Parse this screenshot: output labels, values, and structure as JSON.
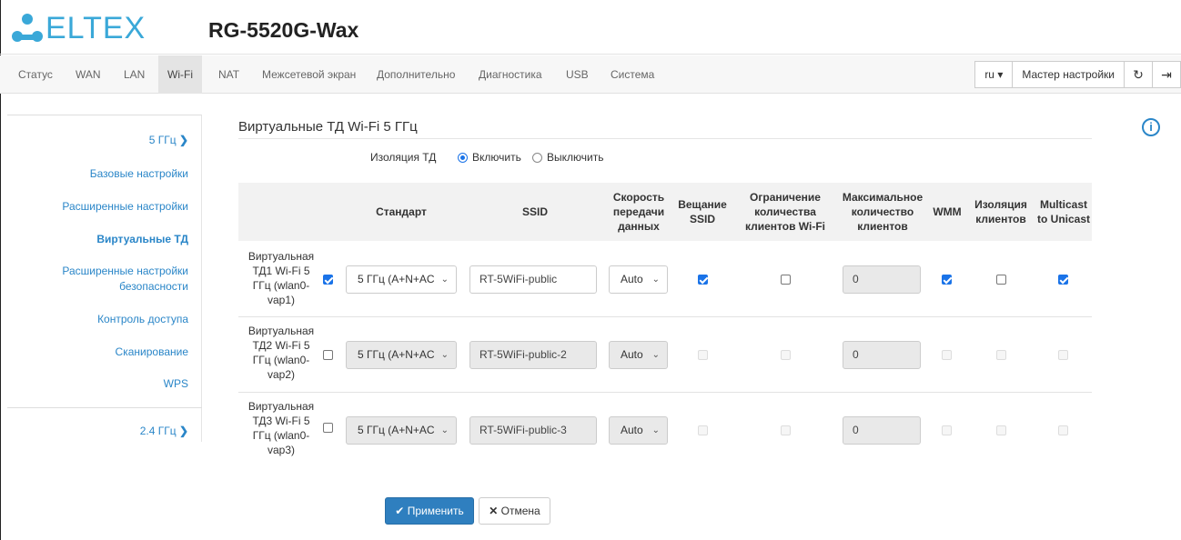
{
  "header": {
    "logo_text": "ELTEX",
    "device_name": "RG-5520G-Wax"
  },
  "topnav": {
    "items": [
      "Статус",
      "WAN",
      "LAN",
      "Wi-Fi",
      "NAT",
      "Межсетевой экран",
      "Дополнительно",
      "Диагностика",
      "USB",
      "Система"
    ],
    "active": "Wi-Fi",
    "lang": "ru ▾",
    "wizard": "Мастер настройки"
  },
  "sidebar": {
    "group_5": "5 ГГц",
    "items": [
      "Базовые настройки",
      "Расширенные настройки",
      "Виртуальные ТД",
      "Расширенные настройки безопасности",
      "Контроль доступа",
      "Сканирование",
      "WPS"
    ],
    "active": "Виртуальные ТД",
    "group_24": "2.4 ГГц"
  },
  "main": {
    "title": "Виртуальные ТД Wi-Fi 5 ГГц",
    "isolation_label": "Изоляция ТД",
    "enable": "Включить",
    "disable": "Выключить",
    "isolation_value": "enable"
  },
  "table": {
    "headers": {
      "standard": "Стандарт",
      "ssid": "SSID",
      "rate": "Скорость передачи данных",
      "broadcast": "Вещание SSID",
      "limit": "Ограничение количества клиентов Wi-Fi",
      "max": "Максимальное количество клиентов",
      "wmm": "WMM",
      "iso": "Изоляция клиентов",
      "mcast": "Multicast to Unicast"
    },
    "rows": [
      {
        "label": "Виртуальная ТД1 Wi-Fi 5 ГГц (wlan0-vap1)",
        "enabled": true,
        "standard": "5 ГГц (A+N+AC",
        "ssid": "RT-5WiFi-public",
        "rate": "Auto",
        "broadcast": true,
        "limit": false,
        "max": "0",
        "wmm": true,
        "iso": false,
        "mcast": true
      },
      {
        "label": "Виртуальная ТД2 Wi-Fi 5 ГГц (wlan0-vap2)",
        "enabled": false,
        "standard": "5 ГГц (A+N+AC",
        "ssid": "RT-5WiFi-public-2",
        "rate": "Auto",
        "broadcast": false,
        "limit": false,
        "max": "0",
        "wmm": false,
        "iso": false,
        "mcast": false
      },
      {
        "label": "Виртуальная ТД3 Wi-Fi 5 ГГц (wlan0-vap3)",
        "enabled": false,
        "standard": "5 ГГц (A+N+AC",
        "ssid": "RT-5WiFi-public-3",
        "rate": "Auto",
        "broadcast": false,
        "limit": false,
        "max": "0",
        "wmm": false,
        "iso": false,
        "mcast": false
      }
    ]
  },
  "actions": {
    "apply": "Применить",
    "cancel": "Отмена"
  },
  "colors": {
    "accent": "#2a86c8",
    "checkbox": "#1a73e8",
    "apply_bg": "#2f7fbf"
  }
}
